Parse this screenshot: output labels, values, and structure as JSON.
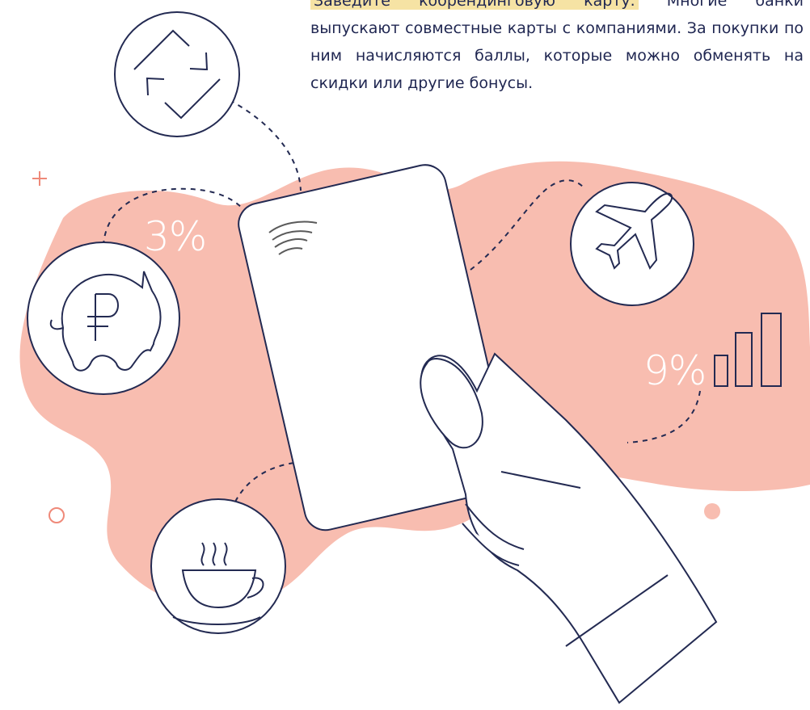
{
  "caption": {
    "highlight": "Заведите кобрендинговую карту.",
    "text": " Многие банки выпускают совместные карты с компаниями. За покупки по ним начисляются баллы, которые можно обменять на скидки или другие бонусы."
  },
  "labels": {
    "percent_left": "3%",
    "percent_right": "9%"
  },
  "icons": [
    "exchange-arrows-icon",
    "piggy-bank-ruble-icon",
    "airplane-icon",
    "bar-chart-icon",
    "coffee-cup-icon",
    "contactless-icon"
  ],
  "colors": {
    "blob": "#f8bdb0",
    "navy_line": "#232a52",
    "text": "#1f2651",
    "highlight": "#f6e3a4",
    "accent": "#ef8979"
  }
}
